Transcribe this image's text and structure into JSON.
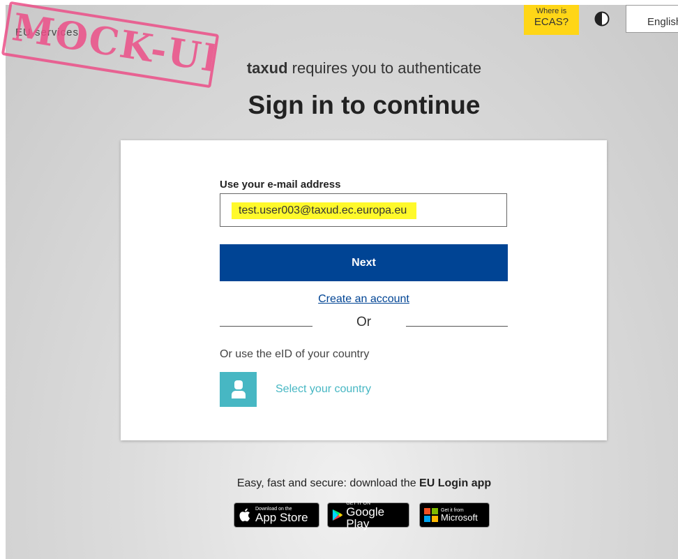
{
  "header": {
    "site_name": "EU services",
    "stamp_text": "MOCK-UP-",
    "where_is_line1": "Where is",
    "where_is_line2": "ECAS?",
    "language": "English"
  },
  "auth": {
    "app_name": "taxud",
    "requires_text": " requires you to authenticate",
    "title": "Sign in to continue"
  },
  "form": {
    "email_label": "Use your e-mail address",
    "email_value": "test.user003@taxud.ec.europa.eu",
    "next_label": "Next",
    "create_account": "Create an account",
    "or": "Or",
    "eid_label": "Or use the eID of your country",
    "select_country": "Select your country"
  },
  "footer": {
    "promo_prefix": "Easy, fast and secure: download the ",
    "promo_app": "EU Login app",
    "apple_small": "Download on the",
    "apple_big": "App Store",
    "google_small": "GET IT ON",
    "google_big": "Google Play",
    "ms_small": "Get it from",
    "ms_big": "Microsoft"
  },
  "colors": {
    "primary": "#004494",
    "accent_yellow": "#ffd617",
    "highlight": "#fff92b",
    "eid_teal": "#47b7c3",
    "stamp_pink": "#ec4f88"
  }
}
